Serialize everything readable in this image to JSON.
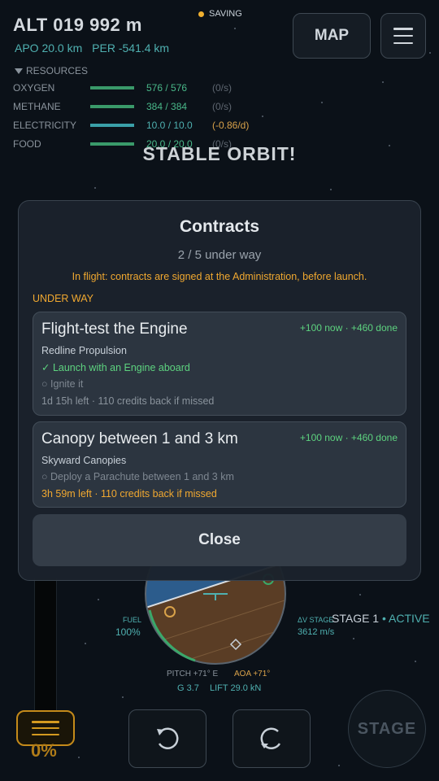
{
  "hud": {
    "altitude": "ALT 019 992 m",
    "apoapsis": "APO 20.0 km",
    "periapsis": "PER -541.4 km",
    "saving_text": "SAVING",
    "map_button": "MAP",
    "menu_icon": "hamburger-icon",
    "status_banner": "STABLE ORBIT!"
  },
  "resources": {
    "title": "RESOURCES",
    "items": [
      {
        "name": "OXYGEN",
        "value": "576 / 576",
        "rate": "(0/s)",
        "fill": 1.0,
        "color": "#3a9a6a"
      },
      {
        "name": "METHANE",
        "value": "384 / 384",
        "rate": "(0/s)",
        "fill": 1.0,
        "color": "#3a9a6a"
      },
      {
        "name": "ELECTRICITY",
        "value": "10.0 / 10.0",
        "rate": "(-0.86/d)",
        "fill": 1.0,
        "color": "#3aa0a8"
      },
      {
        "name": "FOOD",
        "value": "20.0 / 20.0",
        "rate": "(0/s)",
        "fill": 1.0,
        "color": "#3a9a6a"
      }
    ]
  },
  "flight": {
    "fuel_label": "FUEL",
    "fuel_pct": "100%",
    "dv_label": "ΔV STAGE",
    "dv_value": "3612 m/s",
    "stage_label": "STAGE 1",
    "stage_status": "• ACTIVE",
    "pitch": "PITCH +71° E",
    "aoa": "AOA +71°",
    "g": "G 3.7",
    "lift": "LIFT 29.0 kN",
    "throttle_pct": "0%",
    "stage_button": "STAGE"
  },
  "modal": {
    "title": "Contracts",
    "subtitle": "2 / 5 under way",
    "note": "In flight: contracts are signed at the Administration, before launch.",
    "section": "UNDER WAY",
    "contracts": [
      {
        "title": "Flight-test the Engine",
        "reward": "+100 now · +460 done",
        "client": "Redline Propulsion",
        "done_task": "✓ Launch with an Engine aboard",
        "todo_task": "○ Ignite it",
        "deadline": "1d 15h left · 110 credits back if missed"
      },
      {
        "title": "Canopy between 1 and 3 km",
        "reward": "+100 now · +460 done",
        "client": "Skyward Canopies",
        "todo_task": "○ Deploy a Parachute between 1 and 3 km",
        "deadline": "3h 59m left · 110 credits back if missed"
      }
    ],
    "close_label": "Close"
  },
  "colors": {
    "accent_teal": "#4fb0b0",
    "warning_orange": "#f0a830",
    "success_green": "#5dd37f",
    "panel_bg": "#1b222c"
  }
}
